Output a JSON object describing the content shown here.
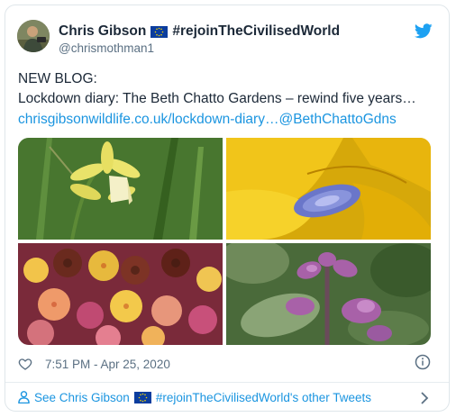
{
  "user": {
    "display_name_before_flag": "Chris Gibson",
    "display_name_after_flag": "#rejoinTheCivilisedWorld",
    "handle": "@chrismothman1"
  },
  "tweet": {
    "line1": "NEW BLOG:",
    "line2": "Lockdown diary: The Beth Chatto Gardens – rewind five years…",
    "link": "chrisgibsonwildlife.co.uk/lockdown-diary…",
    "mention": "@BethChattoGdns"
  },
  "meta": {
    "timestamp": "7:51 PM - Apr 25, 2020"
  },
  "footer": {
    "prefix": "See Chris Gibson",
    "suffix": "#rejoinTheCivilisedWorld's other Tweets"
  },
  "icons": {
    "brand": "twitter-bird-icon",
    "like": "heart-icon",
    "info": "info-icon",
    "profile": "person-icon",
    "more": "chevron-right-icon",
    "flag": "eu-flag-icon"
  },
  "colors": {
    "link": "#1b95e0",
    "text": "#1c2938",
    "muted": "#5b7083",
    "eu_blue": "#0b3d9e",
    "eu_star": "#f6d500"
  }
}
